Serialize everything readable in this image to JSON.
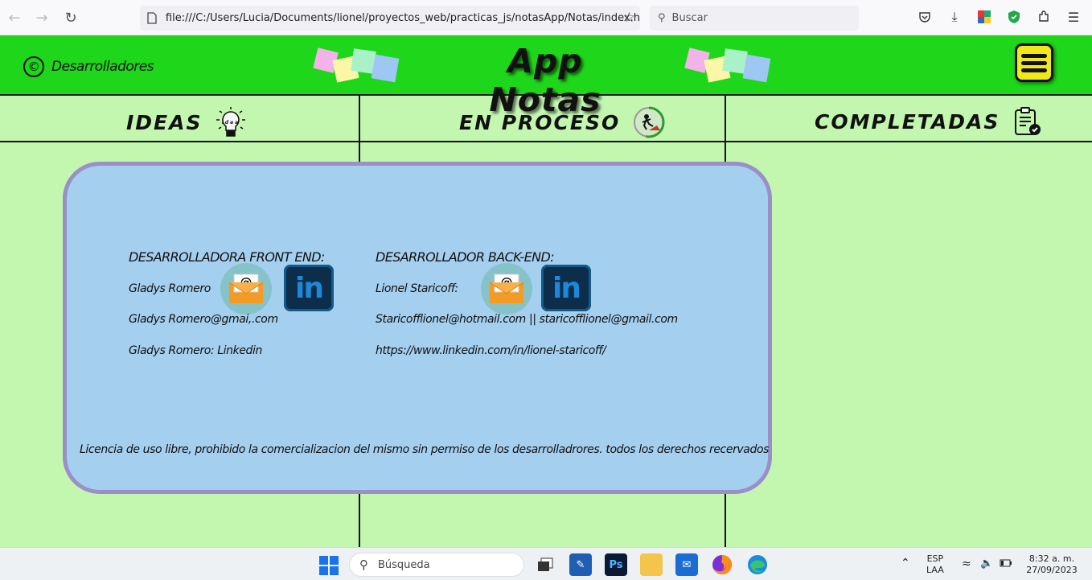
{
  "browser": {
    "url": "file:///C:/Users/Lucia/Documents/lionel/proyectos_web/practicas_js/notasApp/Notas/index.h",
    "search_placeholder": "Buscar"
  },
  "header": {
    "devs_label": "Desarrolladores",
    "title": "App Notas",
    "accent": "#1ed61a"
  },
  "columns": [
    {
      "label": "IDEAS",
      "icon": "lightbulb-icon"
    },
    {
      "label": "EN PROCESO",
      "icon": "worker-icon"
    },
    {
      "label": "COMPLETADAS",
      "icon": "clipboard-check-icon"
    }
  ],
  "modal": {
    "front": {
      "heading": "DESARROLLADORA FRONT END:",
      "name": "Gladys Romero",
      "email": "Gladys Romero@gmai,.com",
      "linkedin": "Gladys Romero: Linkedin"
    },
    "back": {
      "heading": "DESARROLLADOR BACK-END:",
      "name": "Lionel Staricoff:",
      "email": "Staricofflionel@hotmail.com",
      "email2": "|| staricofflionel@gmail.com",
      "linkedin": "https://www.linkedin.com/in/lionel-staricoff/"
    },
    "license": "Licencia de uso libre, prohibido la comercializacion del mismo sin permiso de los desarrolladrores. todos los derechos recervados"
  },
  "taskbar": {
    "search": "Búsqueda",
    "lang1": "ESP",
    "lang2": "LAA",
    "time": "8:32 a. m.",
    "date": "27/09/2023"
  }
}
